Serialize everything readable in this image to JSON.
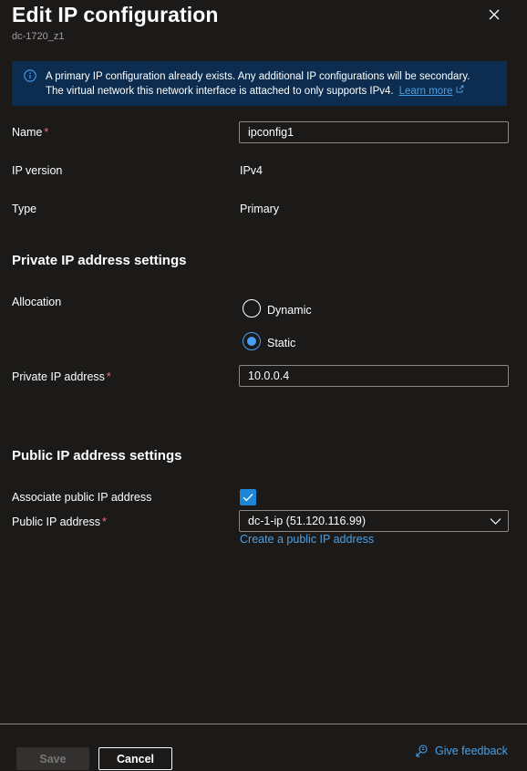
{
  "header": {
    "title": "Edit IP configuration",
    "subtitle": "dc-1720_z1"
  },
  "info": {
    "line1": "A primary IP configuration already exists. Any additional IP configurations will be secondary.",
    "line2": "The virtual network this network interface is attached to only supports IPv4.",
    "link": "Learn more"
  },
  "fields": {
    "name_label": "Name",
    "name_value": "ipconfig1",
    "required_mark": "*",
    "ip_version_label": "IP version",
    "ip_version_value": "IPv4",
    "type_label": "Type",
    "type_value": "Primary"
  },
  "private": {
    "heading": "Private IP address settings",
    "allocation_label": "Allocation",
    "options": [
      "Dynamic",
      "Static"
    ],
    "selected": "Static",
    "address_label": "Private IP address",
    "address_value": "10.0.0.4"
  },
  "public": {
    "heading": "Public IP address settings",
    "associate_label": "Associate public IP address",
    "associate_checked": true,
    "address_label": "Public IP address",
    "address_value": "dc-1-ip (51.120.116.99)",
    "create_link": "Create a public IP address"
  },
  "footer": {
    "save": "Save",
    "cancel": "Cancel",
    "feedback": "Give feedback"
  },
  "colors": {
    "background": "#1b1a19",
    "info_background": "#0c2d50",
    "accent": "#479ef5",
    "link": "#4aa0e6",
    "required": "#f1707b"
  },
  "icons": [
    "info-icon",
    "close-icon",
    "external-link-icon",
    "check-icon",
    "chevron-down-icon",
    "feedback-icon"
  ]
}
